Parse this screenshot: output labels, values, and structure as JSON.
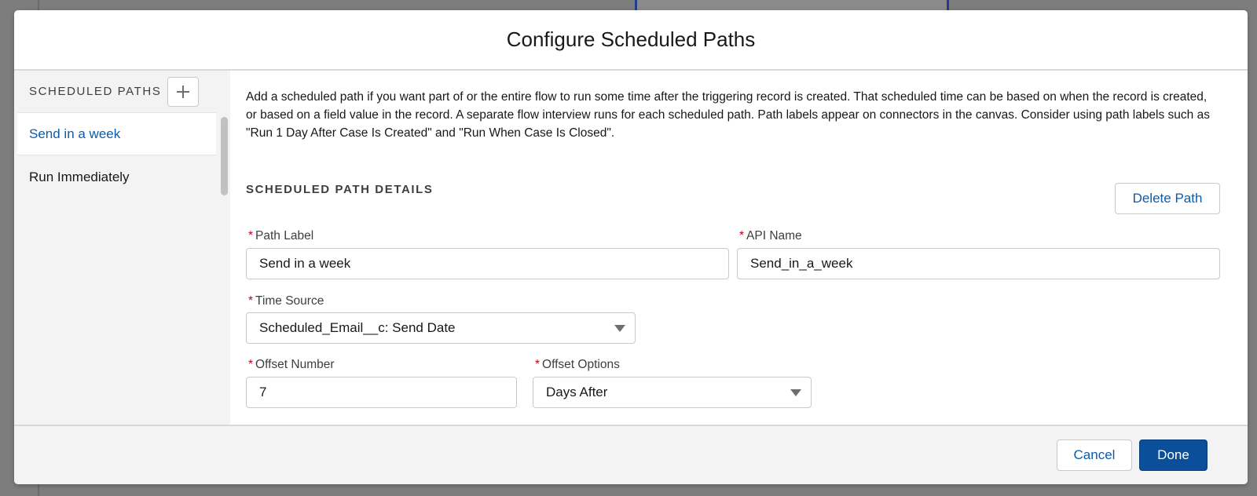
{
  "modal": {
    "title": "Configure Scheduled Paths"
  },
  "sidebar": {
    "title": "SCHEDULED PATHS",
    "items": [
      {
        "label": "Send in a week",
        "active": true
      },
      {
        "label": "Run Immediately",
        "active": false
      }
    ]
  },
  "main": {
    "intro": "Add a scheduled path if you want part of or the entire flow to run some time after the triggering record is created. That scheduled time can be based on when the record is created, or based on a field value in the record. A separate flow interview runs for each scheduled path. Path labels appear on connectors in the canvas. Consider using path labels such as \"Run 1 Day After Case Is Created\" and \"Run When Case Is Closed\".",
    "section_title": "SCHEDULED PATH DETAILS",
    "delete_label": "Delete Path",
    "required_marker": "*",
    "fields": {
      "path_label": {
        "label": "Path Label",
        "value": "Send in a week"
      },
      "api_name": {
        "label": "API Name",
        "value": "Send_in_a_week"
      },
      "time_source": {
        "label": "Time Source",
        "value": "Scheduled_Email__c: Send Date"
      },
      "offset_number": {
        "label": "Offset Number",
        "value": "7"
      },
      "offset_options": {
        "label": "Offset Options",
        "value": "Days After"
      }
    }
  },
  "footer": {
    "cancel_label": "Cancel",
    "done_label": "Done"
  },
  "colors": {
    "brand": "#0b4f9a",
    "link": "#0b5cab",
    "required": "#ba0517"
  }
}
